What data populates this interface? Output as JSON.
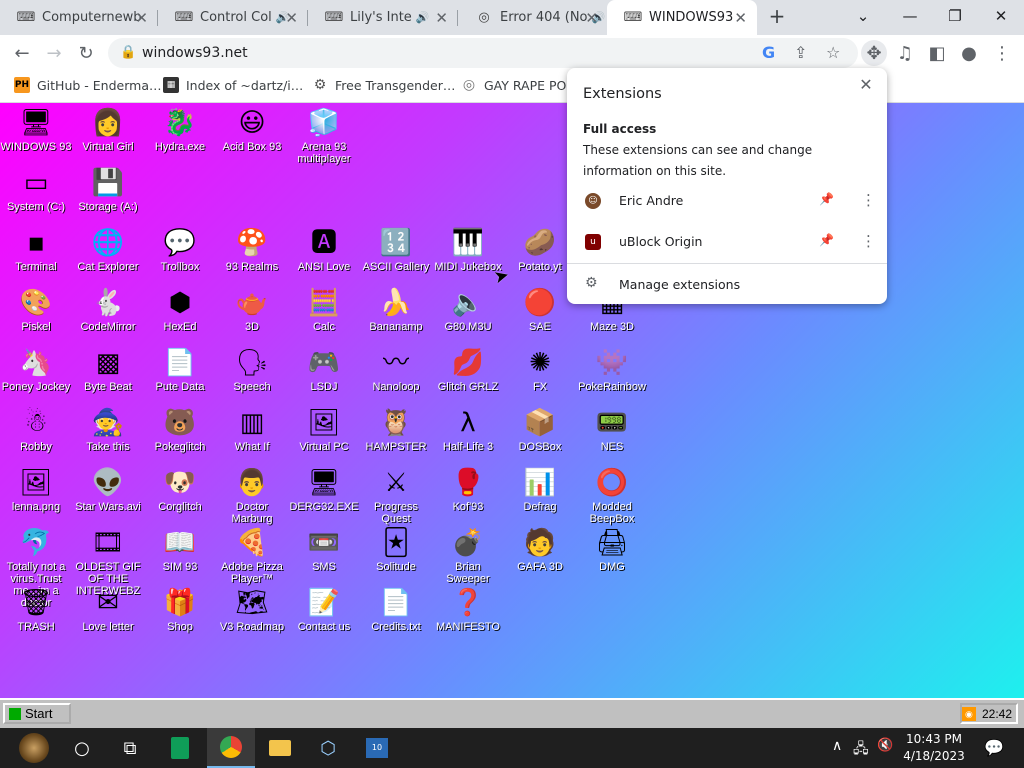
{
  "tabs": [
    {
      "title": "Computernewb",
      "fav": "⌨",
      "audio": false
    },
    {
      "title": "Control Col",
      "fav": "⌨",
      "audio": true
    },
    {
      "title": "Lily's Inte",
      "fav": "⌨",
      "audio": true
    },
    {
      "title": "Error 404 (No",
      "fav": "◎",
      "audio": true
    },
    {
      "title": "WINDOWS93",
      "fav": "⌨",
      "audio": false,
      "active": true
    }
  ],
  "toolbar": {
    "url": "windows93.net"
  },
  "bookmarks": [
    {
      "label": "GitHub - Enderma…",
      "badge": "PH",
      "color": "#f7971e"
    },
    {
      "label": "Index of ~dartz/i…",
      "badge": "▦",
      "color": "#333"
    },
    {
      "label": "Free Transgender…",
      "badge": "⚙",
      "color": "#555"
    },
    {
      "label": "GAY RAPE POR",
      "badge": "◎",
      "color": "#777"
    }
  ],
  "desktop": {
    "icons": [
      {
        "label": "WINDOWS 93",
        "glyph": "🖥"
      },
      {
        "label": "Virtual Girl",
        "glyph": "👩"
      },
      {
        "label": "Hydra.exe",
        "glyph": "🐉"
      },
      {
        "label": "Acid Box 93",
        "glyph": "😃"
      },
      {
        "label": "Arena 93 multiplayer",
        "glyph": "🧊"
      },
      {
        "label": "System (C:)",
        "glyph": "▭"
      },
      {
        "label": "Storage (A:)",
        "glyph": "💾"
      },
      {
        "label": "Terminal",
        "glyph": "▪"
      },
      {
        "label": "Cat Explorer",
        "glyph": "🌐"
      },
      {
        "label": "Trollbox",
        "glyph": "💬"
      },
      {
        "label": "93 Realms",
        "glyph": "🍄"
      },
      {
        "label": "ANSI Love",
        "glyph": "🅰"
      },
      {
        "label": "ASCII Gallery",
        "glyph": "🔢"
      },
      {
        "label": "MIDI Jukebox",
        "glyph": "🎹"
      },
      {
        "label": "Potato.yt",
        "glyph": "🥔"
      },
      {
        "label": "Piskel",
        "glyph": "🎨"
      },
      {
        "label": "CodeMirror",
        "glyph": "🐇"
      },
      {
        "label": "HexEd",
        "glyph": "⬢"
      },
      {
        "label": "3D",
        "glyph": "🫖"
      },
      {
        "label": "Calc",
        "glyph": "🧮"
      },
      {
        "label": "Bananamp",
        "glyph": "🍌"
      },
      {
        "label": "G80.M3U",
        "glyph": "🔈"
      },
      {
        "label": "SAE",
        "glyph": "🔴"
      },
      {
        "label": "Maze 3D",
        "glyph": "▦"
      },
      {
        "label": "Poney Jockey",
        "glyph": "🦄"
      },
      {
        "label": "Byte Beat",
        "glyph": "▩"
      },
      {
        "label": "Pute Data",
        "glyph": "📄"
      },
      {
        "label": "Speech",
        "glyph": "🗣"
      },
      {
        "label": "LSDJ",
        "glyph": "🎮"
      },
      {
        "label": "Nanoloop",
        "glyph": "〰"
      },
      {
        "label": "Glitch GRLZ",
        "glyph": "💋"
      },
      {
        "label": "FX",
        "glyph": "✺"
      },
      {
        "label": "PokeRainbow",
        "glyph": "👾"
      },
      {
        "label": "Robby",
        "glyph": "☃"
      },
      {
        "label": "Take this",
        "glyph": "🧙"
      },
      {
        "label": "Pokeglitch",
        "glyph": "🐻"
      },
      {
        "label": "What If",
        "glyph": "▥"
      },
      {
        "label": "Virtual PC",
        "glyph": "🖼"
      },
      {
        "label": "HAMPSTER",
        "glyph": "🦉"
      },
      {
        "label": "Half-Life 3",
        "glyph": "λ"
      },
      {
        "label": "DOSBox",
        "glyph": "📦"
      },
      {
        "label": "NES",
        "glyph": "📟"
      },
      {
        "label": "lenna.png",
        "glyph": "🖼"
      },
      {
        "label": "Star Wars.avi",
        "glyph": "👽"
      },
      {
        "label": "Corglitch",
        "glyph": "🐶"
      },
      {
        "label": "Doctor Marburg",
        "glyph": "👨"
      },
      {
        "label": "DERG32.EXE",
        "glyph": "🖥"
      },
      {
        "label": "Progress Quest",
        "glyph": "⚔"
      },
      {
        "label": "Kof'93",
        "glyph": "🥊"
      },
      {
        "label": "Defrag",
        "glyph": "📊"
      },
      {
        "label": "Modded BeepBox",
        "glyph": "⭕"
      },
      {
        "label": "Totally not a virus.Trust me...im a doctor",
        "glyph": "🐬"
      },
      {
        "label": "OLDEST GIF OF THE INTERWEBZ",
        "glyph": "🎞"
      },
      {
        "label": "SIM 93",
        "glyph": "📖"
      },
      {
        "label": "Adobe Pizza Player™",
        "glyph": "🍕"
      },
      {
        "label": "SMS",
        "glyph": "📼"
      },
      {
        "label": "Solitude",
        "glyph": "🃏"
      },
      {
        "label": "Brian Sweeper",
        "glyph": "💣"
      },
      {
        "label": "GAFA 3D",
        "glyph": "🧑"
      },
      {
        "label": "DMG",
        "glyph": "🖨"
      },
      {
        "label": "TRASH",
        "glyph": "🗑"
      },
      {
        "label": "Love letter",
        "glyph": "✉"
      },
      {
        "label": "Shop",
        "glyph": "🎁"
      },
      {
        "label": "V3 Roadmap",
        "glyph": "🗺"
      },
      {
        "label": "Contact us",
        "glyph": "📝"
      },
      {
        "label": "Credits.txt",
        "glyph": "📄"
      },
      {
        "label": "MANIFESTO",
        "glyph": "❓"
      }
    ]
  },
  "win93_taskbar": {
    "start_label": "Start",
    "clock": "22:42"
  },
  "extensions_popup": {
    "title": "Extensions",
    "section_heading": "Full access",
    "section_desc": "These extensions can see and change information on this site.",
    "items": [
      {
        "name": "Eric Andre",
        "color": "#7a4a2a"
      },
      {
        "name": "uBlock Origin",
        "color": "#800000"
      }
    ],
    "manage_label": "Manage extensions"
  },
  "win_taskbar": {
    "time": "10:43 PM",
    "date": "4/18/2023"
  }
}
